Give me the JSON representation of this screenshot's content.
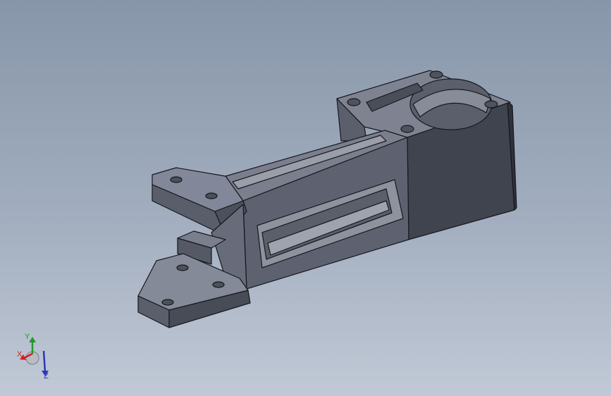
{
  "viewport": {
    "background_top": "#8796a9",
    "background_bottom": "#c1c9d6"
  },
  "model": {
    "icon": "cad-part-bracket",
    "color_top": "#7c808e",
    "color_side": "#5a5e6b",
    "color_dark": "#3f434e",
    "edge_color": "#16181d"
  },
  "triad": {
    "x_label": "X",
    "y_label": "Y",
    "z_label": "Z",
    "x_color": "#d42020",
    "y_color": "#1f9a2a",
    "z_color": "#2a39b8"
  }
}
